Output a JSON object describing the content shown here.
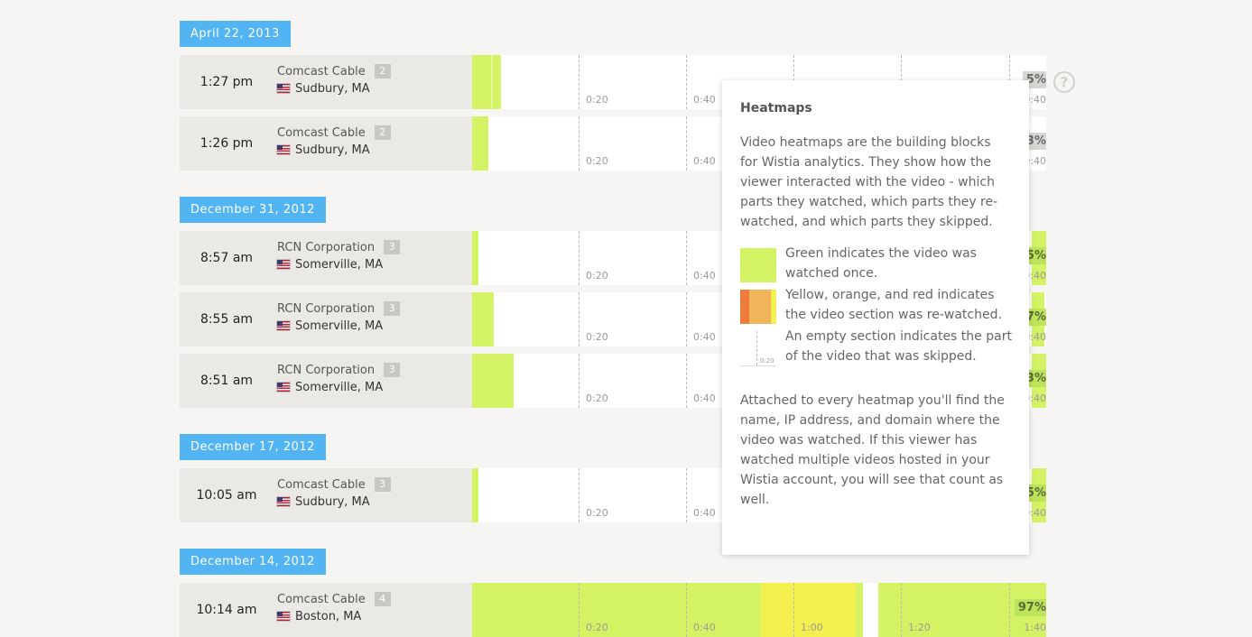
{
  "groups": [
    {
      "date": "April 22, 2013",
      "rows": [
        {
          "time": "1:27 pm",
          "org": "Comcast Cable",
          "count": "2",
          "location": "Sudbury, MA",
          "pct": "5%",
          "end_tick": "0:40"
        },
        {
          "time": "1:26 pm",
          "org": "Comcast Cable",
          "count": "2",
          "location": "Sudbury, MA",
          "pct": "3%",
          "end_tick": "0:40"
        }
      ]
    },
    {
      "date": "December 31, 2012",
      "rows": [
        {
          "time": "8:57 am",
          "org": "RCN Corporation",
          "count": "3",
          "location": "Somerville, MA",
          "pct": "5%",
          "end_tick": "0:40"
        },
        {
          "time": "8:55 am",
          "org": "RCN Corporation",
          "count": "3",
          "location": "Somerville, MA",
          "pct": "7%",
          "end_tick": "0:40"
        },
        {
          "time": "8:51 am",
          "org": "RCN Corporation",
          "count": "3",
          "location": "Somerville, MA",
          "pct": "3%",
          "end_tick": "0:40"
        }
      ]
    },
    {
      "date": "December 17, 2012",
      "rows": [
        {
          "time": "10:05 am",
          "org": "Comcast Cable",
          "count": "3",
          "location": "Sudbury, MA",
          "pct": "5%",
          "end_tick": "0:40"
        }
      ]
    },
    {
      "date": "December 14, 2012",
      "rows": [
        {
          "time": "10:14 am",
          "org": "Comcast Cable",
          "count": "4",
          "location": "Boston, MA",
          "pct": "97%",
          "end_tick": "1:40"
        }
      ]
    }
  ],
  "ticks": [
    "0:20",
    "0:40",
    "1:00",
    "1:20"
  ],
  "help_icon": "question-circle-icon",
  "popover": {
    "title": "Heatmaps",
    "intro": "Video heatmaps are the building blocks for Wistia analytics. They show how the viewer interacted with the video - which parts they watched, which parts they re-watched, and which parts they skipped.",
    "legend_green": "Green indicates the video was watched once.",
    "legend_rewatch": "Yellow, orange, and red indicates the video section was re-watched.",
    "legend_empty": "An empty section indicates the part of the video that was skipped.",
    "legend_empty_tick": "0:20",
    "outro": "Attached to every heatmap you'll find the name, IP address, and domain where the video was watched. If this viewer has watched multiple videos hosted in your Wistia account, you will see that count as well."
  },
  "colors": {
    "date_bg": "#52b4f2",
    "watched": "#d3f264",
    "rewatched_yellow": "#f2ef4e",
    "rewatched_orange": "#f2b45a",
    "rewatched_red": "#ee7a3c"
  }
}
